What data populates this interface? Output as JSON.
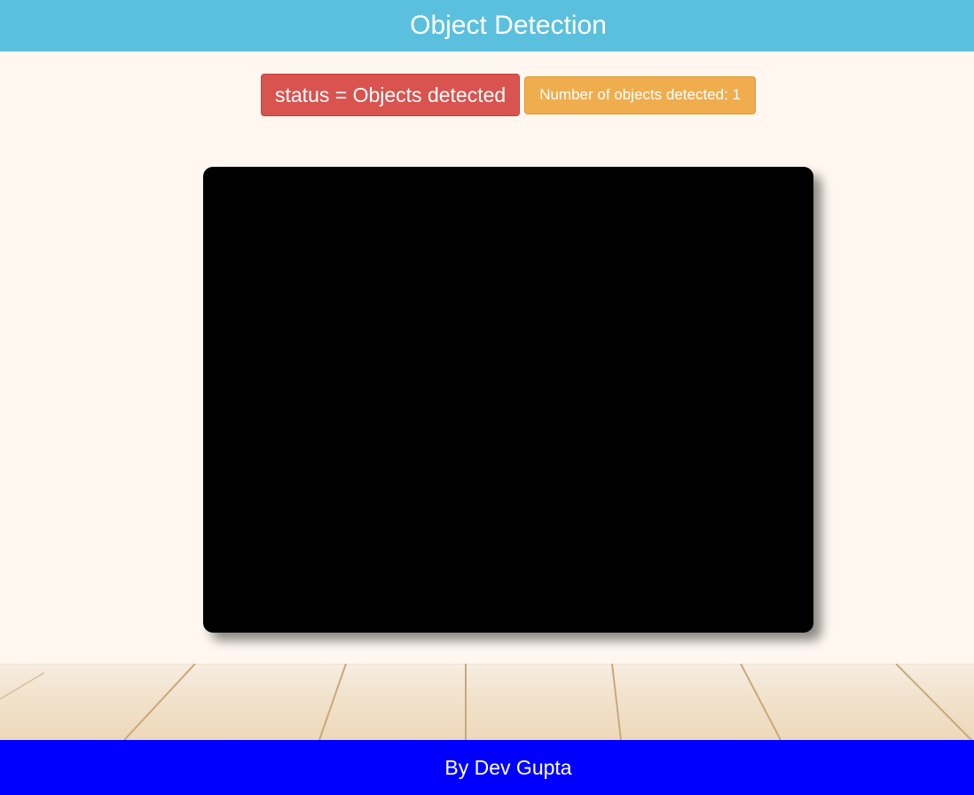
{
  "header": {
    "title": "Object Detection"
  },
  "status": {
    "label": "status = Objects detected",
    "count_label": "Number of objects detected: 1"
  },
  "footer": {
    "text": "By Dev Gupta"
  },
  "colors": {
    "header_bg": "#5bc0de",
    "status_badge": "#d9534f",
    "count_badge": "#f0ad4e",
    "footer_bg": "#0000ff",
    "page_bg": "#fff7f0",
    "video_bg": "#000000"
  }
}
